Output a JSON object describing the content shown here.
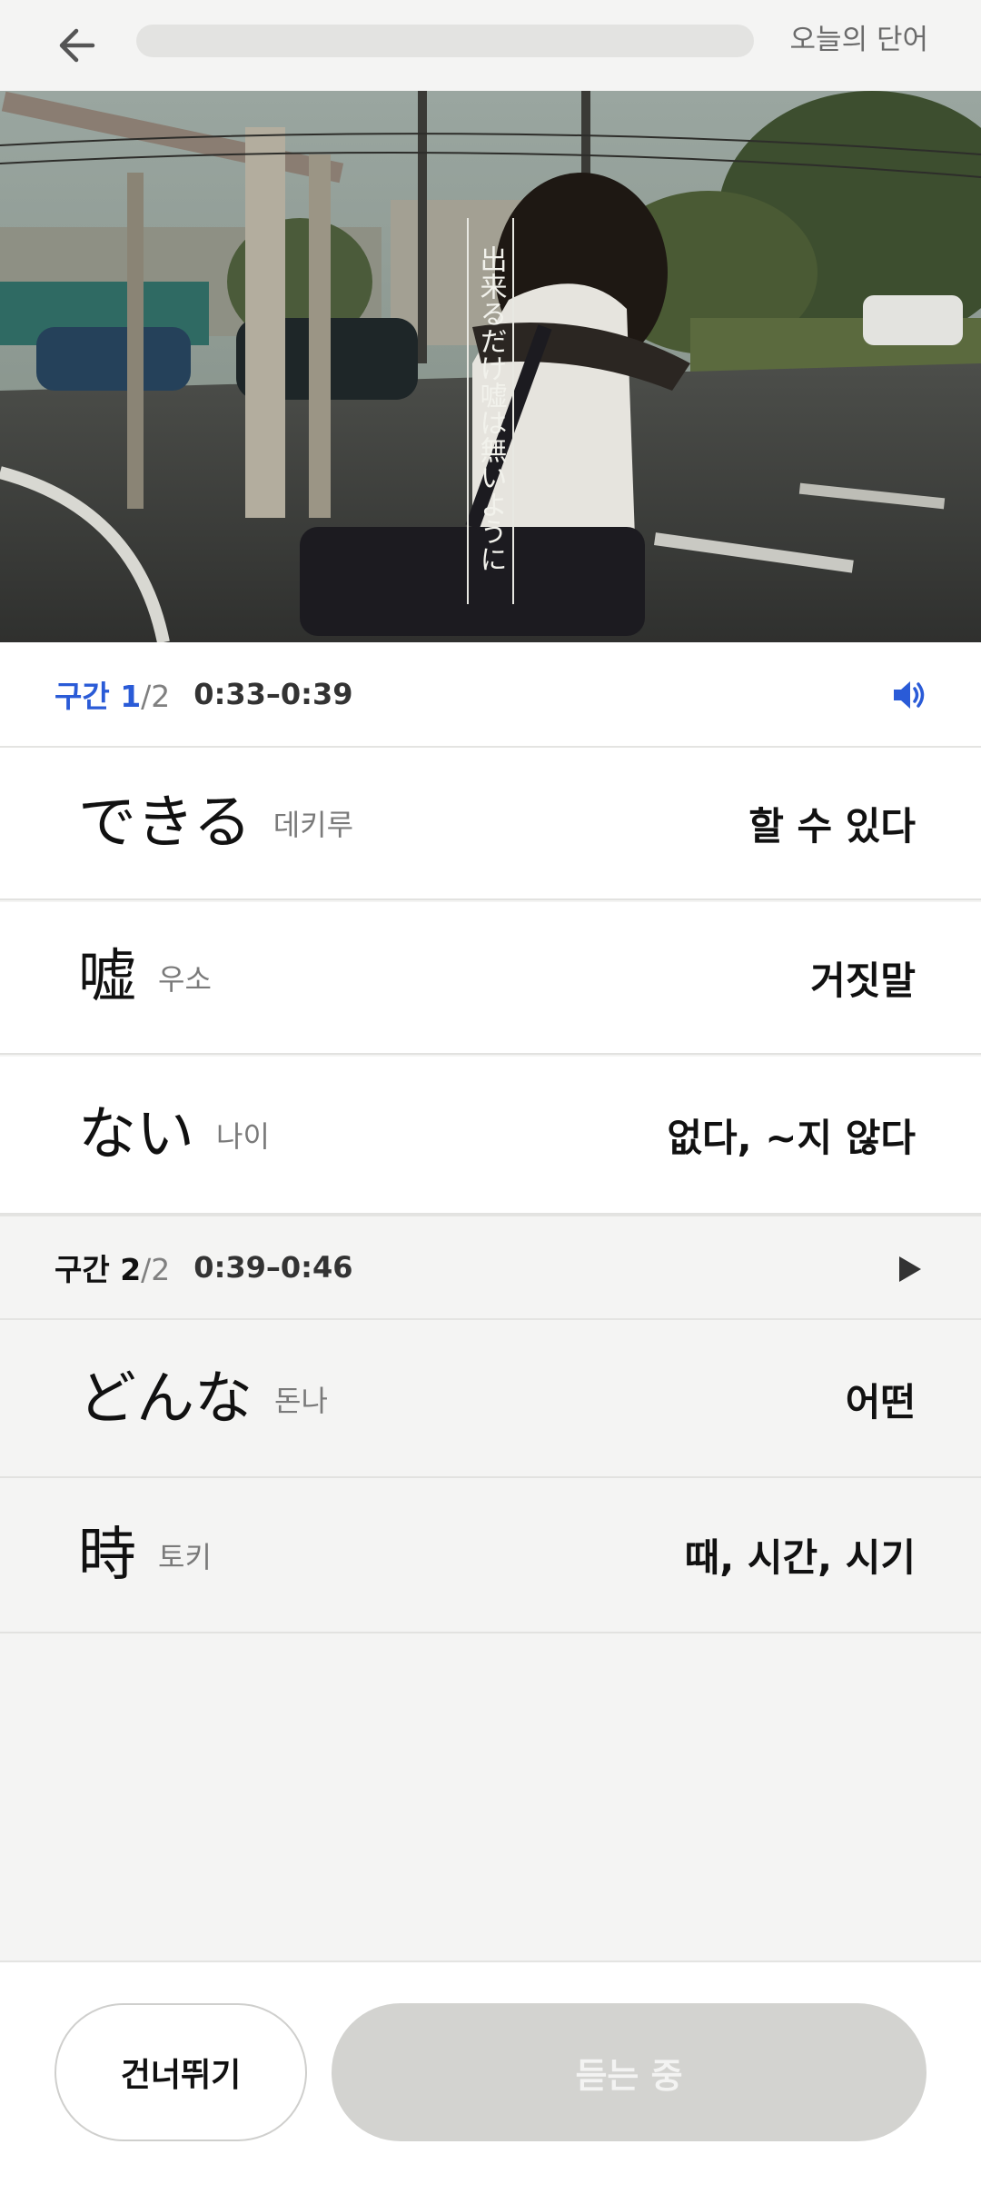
{
  "header": {
    "title": "오늘의 단어",
    "progress": 0.0
  },
  "video": {
    "caption_vertical": "出来るだけ嘘は無いように"
  },
  "sections": [
    {
      "label": "구간 1",
      "total": "/2",
      "time": "0:33–0:39",
      "icon": "speaker-icon",
      "active": true,
      "accent": "#2a5bd7",
      "words": [
        {
          "jp": "できる",
          "reading": "데키루",
          "meaning": "할 수 있다"
        },
        {
          "jp": "嘘",
          "reading": "우소",
          "meaning": "거짓말"
        },
        {
          "jp": "ない",
          "reading": "나이",
          "meaning": "없다, ~지 않다"
        }
      ]
    },
    {
      "label": "구간 2",
      "total": "/2",
      "time": "0:39–0:46",
      "icon": "play-icon",
      "active": false,
      "words": [
        {
          "jp": "どんな",
          "reading": "돈나",
          "meaning": "어떤"
        },
        {
          "jp": "時",
          "reading": "토키",
          "meaning": "때, 시간, 시기"
        }
      ]
    }
  ],
  "bottom": {
    "skip_label": "건너뛰기",
    "listening_label": "듣는 중"
  }
}
